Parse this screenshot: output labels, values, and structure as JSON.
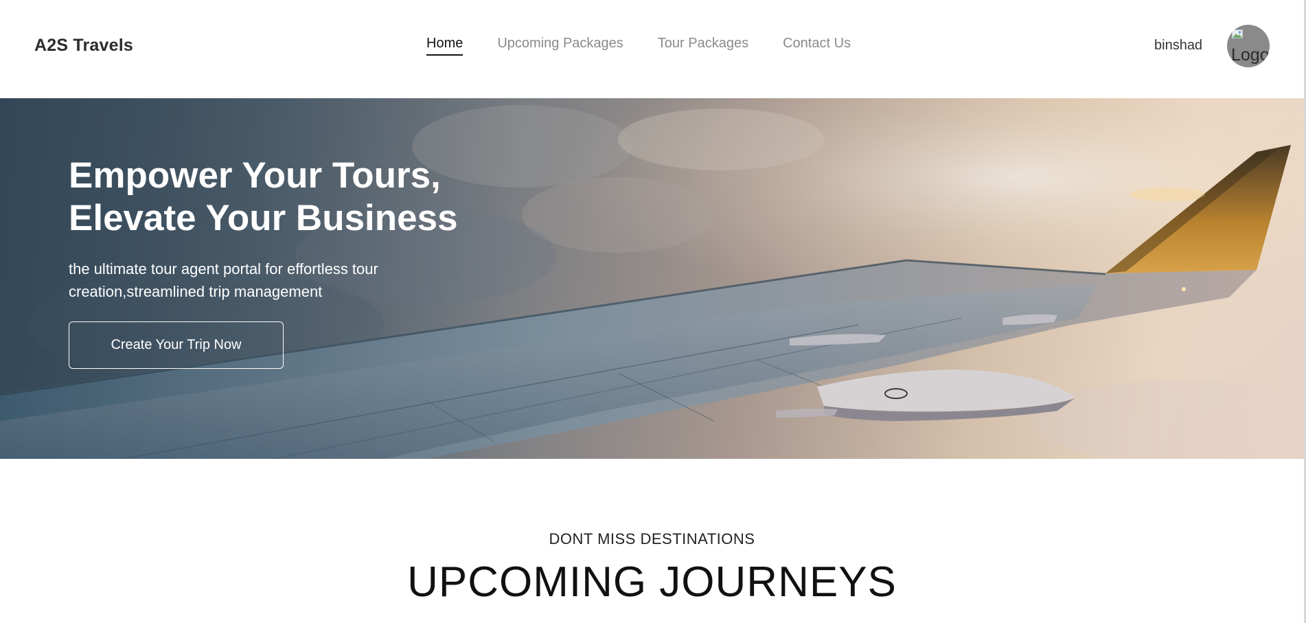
{
  "brand": {
    "name": "A2S Travels"
  },
  "nav": {
    "items": [
      {
        "label": "Home",
        "active": true
      },
      {
        "label": "Upcoming Packages",
        "active": false
      },
      {
        "label": "Tour Packages",
        "active": false
      },
      {
        "label": "Contact Us",
        "active": false
      }
    ]
  },
  "user": {
    "name": "binshad",
    "avatar_alt": "Logo",
    "avatar_icon": "broken-image-icon"
  },
  "hero": {
    "title_line1": "Empower Your Tours,",
    "title_line2": "Elevate Your Business",
    "subtitle": "the ultimate tour agent portal for effortless tour creation,streamlined trip management",
    "cta_label": "Create Your Trip Now"
  },
  "section": {
    "kicker": "DONT MISS DESTINATIONS",
    "title": "UPCOMING JOURNEYS"
  },
  "colors": {
    "nav_active": "#111111",
    "nav_inactive": "#8a8a8a",
    "hero_text": "#ffffff",
    "avatar_bg": "#8a8a8a"
  }
}
